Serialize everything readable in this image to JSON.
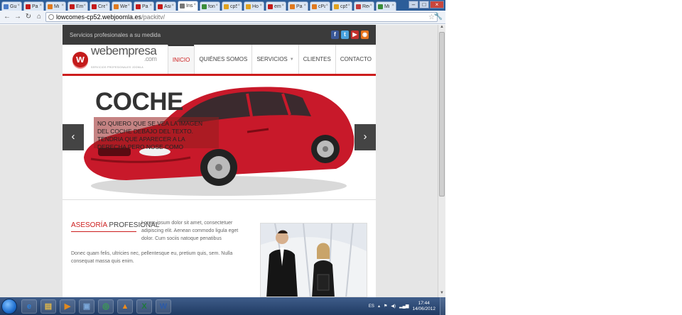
{
  "browser": {
    "tabs": [
      {
        "label": "Gu",
        "color": "#4a7cc7",
        "active": false
      },
      {
        "label": "Pa",
        "color": "#c41b1b",
        "active": false
      },
      {
        "label": "Mi",
        "color": "#e07a1f",
        "active": false
      },
      {
        "label": "Em",
        "color": "#c41b1b",
        "active": false
      },
      {
        "label": "Cre",
        "color": "#c41b1b",
        "active": false
      },
      {
        "label": "We",
        "color": "#e07a1f",
        "active": false
      },
      {
        "label": "Pa",
        "color": "#c41b1b",
        "active": false
      },
      {
        "label": "Asi",
        "color": "#c41b1b",
        "active": false
      },
      {
        "label": "Ins",
        "color": "#777777",
        "active": true
      },
      {
        "label": "fon",
        "color": "#3b8d3b",
        "active": false
      },
      {
        "label": "cp5",
        "color": "#e0a21f",
        "active": false
      },
      {
        "label": "Ho",
        "color": "#e0a21f",
        "active": false
      },
      {
        "label": "em",
        "color": "#c41b1b",
        "active": false
      },
      {
        "label": "Pa",
        "color": "#e07a1f",
        "active": false
      },
      {
        "label": "cPa",
        "color": "#e07a1f",
        "active": false
      },
      {
        "label": "cp5",
        "color": "#e0a21f",
        "active": false
      },
      {
        "label": "Rec",
        "color": "#c43b3b",
        "active": false
      },
      {
        "label": "Mi",
        "color": "#3b8d3b",
        "active": false
      }
    ],
    "url_host": "lowcomes-cp52.webjoomla.es",
    "url_path": "/packitv/"
  },
  "site": {
    "topbar_text": "Servicios profesionales a su medida",
    "social": [
      {
        "name": "facebook",
        "glyph": "f",
        "color": "#3b5998"
      },
      {
        "name": "twitter",
        "glyph": "t",
        "color": "#4aa3df"
      },
      {
        "name": "youtube",
        "glyph": "▶",
        "color": "#c4302b"
      },
      {
        "name": "rss",
        "glyph": "◉",
        "color": "#e8741c"
      }
    ],
    "logo": {
      "mark": "w",
      "word": "webempresa",
      "dotcom": ".com",
      "slogan": "SERVICIOS PROFESIONALES JOOMLA"
    },
    "menu": [
      {
        "label": "Inicio",
        "active": true,
        "caret": ""
      },
      {
        "label": "Quiénes somos",
        "active": false,
        "caret": ""
      },
      {
        "label": "Servicios",
        "active": false,
        "caret": "▼"
      },
      {
        "label": "Clientes",
        "active": false,
        "caret": ""
      },
      {
        "label": "Contacto",
        "active": false,
        "caret": ""
      }
    ],
    "slider": {
      "title": "COCHE",
      "caption": "NO QUIERO QUE SE VEA LA IMAGEN DEL COCHE DEBAJO DEL TEXTO. TENDRIA QUE APARECER A LA DERECHA PERO NOSE COMO",
      "prev": "‹",
      "next": "›"
    },
    "section": {
      "title_red": "Asesoría",
      "title_rest": " Profesional",
      "para1": "Lorem ipsum dolor sit amet, consectetuer adipiscing elit. Aenean commodo ligula eget dolor. Cum sociis natoque penatibus",
      "para2": "Donec quam felis, ultricies nec, pellentesque eu, pretium quis, sem. Nulla consequat massa quis enim."
    }
  },
  "taskbar": {
    "apps": [
      {
        "name": "ie",
        "glyph": "e",
        "color": "#2f7fd6"
      },
      {
        "name": "explorer",
        "glyph": "▤",
        "color": "#e1b84a"
      },
      {
        "name": "media",
        "glyph": "▶",
        "color": "#e0891f"
      },
      {
        "name": "window",
        "glyph": "▣",
        "color": "#7aa6d8"
      },
      {
        "name": "chrome",
        "glyph": "◎",
        "color": "#3aa54a"
      },
      {
        "name": "vlc",
        "glyph": "▲",
        "color": "#f08c1c"
      },
      {
        "name": "excel",
        "glyph": "X",
        "color": "#1e7a3a"
      },
      {
        "name": "word",
        "glyph": "W",
        "color": "#2b5aa8"
      }
    ],
    "lang": "ES",
    "time": "17:44",
    "date": "14/06/2012"
  }
}
